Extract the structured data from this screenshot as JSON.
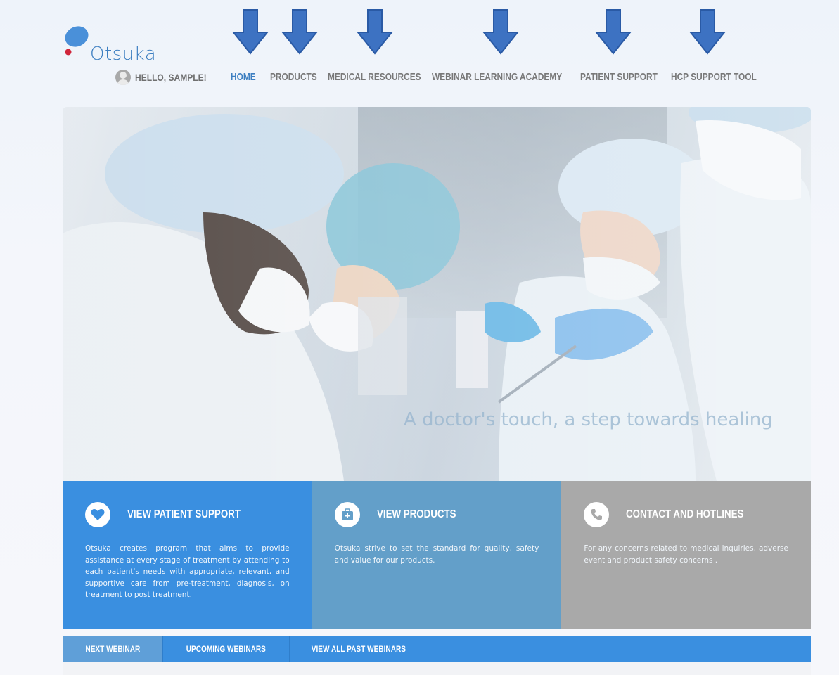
{
  "brand": {
    "name": "Otsuka"
  },
  "greeting": {
    "text": "HELLO, SAMPLE!"
  },
  "nav": {
    "items": [
      {
        "label": "HOME",
        "active": true
      },
      {
        "label": "PRODUCTS",
        "active": false
      },
      {
        "label": "MEDICAL RESOURCES",
        "active": false
      },
      {
        "label": "WEBINAR LEARNING ACADEMY",
        "active": false
      },
      {
        "label": "PATIENT SUPPORT",
        "active": false
      },
      {
        "label": "HCP SUPPORT TOOL",
        "active": false
      }
    ]
  },
  "hero": {
    "tagline": "A doctor's touch, a step towards healing"
  },
  "panels": [
    {
      "title": "VIEW PATIENT SUPPORT",
      "icon": "heart-icon",
      "description": "Otsuka creates program that aims to provide assistance at every stage of treatment by attending to each patient's needs with appropriate, relevant, and supportive care from pre-treatment, diagnosis, on treatment to post treatment."
    },
    {
      "title": "VIEW PRODUCTS",
      "icon": "medical-kit-icon",
      "description": "Otsuka strive to set the standard for quality, safety and value for our products."
    },
    {
      "title": "CONTACT AND HOTLINES",
      "icon": "phone-icon",
      "description": "For any concerns related to medical inquiries, adverse event and product safety concerns ."
    }
  ],
  "webinar_tabs": [
    {
      "label": "NEXT WEBINAR",
      "active": true
    },
    {
      "label": "UPCOMING WEBINARS",
      "active": false
    },
    {
      "label": "VIEW ALL PAST WEBINARS",
      "active": false
    }
  ],
  "colors": {
    "accent": "#3d7fc1",
    "panel_patient": "#3a8fe0",
    "panel_products": "#639fc9",
    "panel_contact": "#a9a9a9",
    "arrow": "#3d72c2"
  }
}
